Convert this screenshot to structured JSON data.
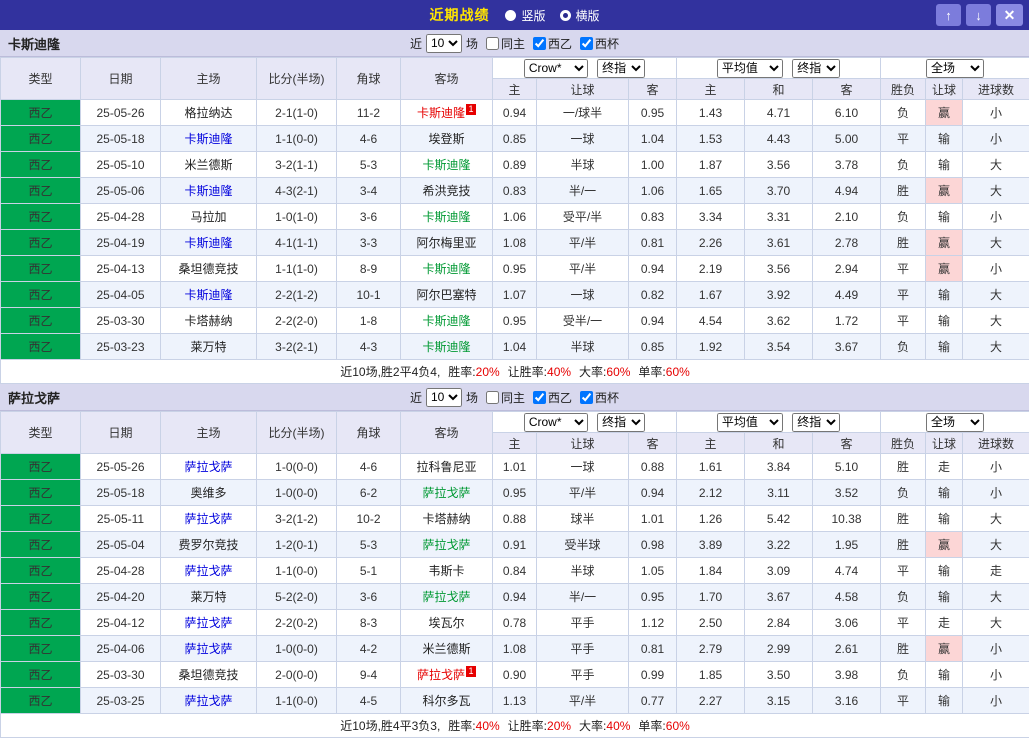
{
  "topbar": {
    "title": "近期战绩",
    "radios": [
      {
        "label": "竖版",
        "checked": false
      },
      {
        "label": "横版",
        "checked": true
      }
    ],
    "buttons": {
      "up": "↑",
      "down": "↓",
      "close": "✕"
    }
  },
  "colors": {
    "bar_purple": "#32329e",
    "title_yellow": "#ffe400",
    "league_green": "#00a651",
    "score_red": "#e60000",
    "home_team_blue": "#0000dd",
    "away_team_green": "#009933",
    "result_red": "#e60000",
    "result_blue": "#0000e6",
    "result_green": "#009933",
    "section_bar": "#d8d8ee",
    "header_lavender": "#e7e7f6",
    "row_alt": "#eef3fc"
  },
  "sections": [
    {
      "team": "卡斯迪隆",
      "filter": {
        "near": "近",
        "count": "10",
        "games": "场",
        "checkboxes": [
          {
            "label": "同主",
            "checked": false
          },
          {
            "label": "西乙",
            "checked": true
          },
          {
            "label": "西杯",
            "checked": true
          }
        ]
      },
      "columns": {
        "type": "类型",
        "date": "日期",
        "home": "主场",
        "score": "比分(半场)",
        "corner": "角球",
        "away": "客场"
      },
      "dropdowns": {
        "asia_company": "Crow*",
        "asia_final": "终指",
        "euro_company": "平均值",
        "euro_final": "终指",
        "scope": "全场"
      },
      "subcols": [
        "主",
        "让球",
        "客",
        "主",
        "和",
        "客",
        "胜负",
        "让球",
        "进球数"
      ],
      "rows": [
        {
          "league": "西乙",
          "date": "25-05-26",
          "home": "格拉纳达",
          "home_color": "black",
          "away": "卡斯迪隆",
          "away_color": "red",
          "away_badge": "1",
          "score": "2-1(1-0)",
          "corner": "11-2",
          "asia": [
            "0.94",
            "一/球半",
            "0.95"
          ],
          "euro": [
            "1.43",
            "4.71",
            "6.10"
          ],
          "result": [
            "负",
            "赢",
            "小"
          ]
        },
        {
          "league": "西乙",
          "date": "25-05-18",
          "home": "卡斯迪隆",
          "home_color": "blue",
          "away": "埃登斯",
          "away_color": "black",
          "score": "1-1(0-0)",
          "corner": "4-6",
          "asia": [
            "0.85",
            "一球",
            "1.04"
          ],
          "euro": [
            "1.53",
            "4.43",
            "5.00"
          ],
          "result": [
            "平",
            "输",
            "小"
          ]
        },
        {
          "league": "西乙",
          "date": "25-05-10",
          "home": "米兰德斯",
          "home_color": "black",
          "away": "卡斯迪隆",
          "away_color": "green",
          "score": "3-2(1-1)",
          "corner": "5-3",
          "asia": [
            "0.89",
            "半球",
            "1.00"
          ],
          "euro": [
            "1.87",
            "3.56",
            "3.78"
          ],
          "result": [
            "负",
            "输",
            "大"
          ]
        },
        {
          "league": "西乙",
          "date": "25-05-06",
          "home": "卡斯迪隆",
          "home_color": "blue",
          "away": "希洪竞技",
          "away_color": "black",
          "score": "4-3(2-1)",
          "corner": "3-4",
          "asia": [
            "0.83",
            "半/一",
            "1.06"
          ],
          "euro": [
            "1.65",
            "3.70",
            "4.94"
          ],
          "result": [
            "胜",
            "赢",
            "大"
          ]
        },
        {
          "league": "西乙",
          "date": "25-04-28",
          "home": "马拉加",
          "home_color": "black",
          "away": "卡斯迪隆",
          "away_color": "green",
          "score": "1-0(1-0)",
          "corner": "3-6",
          "asia": [
            "1.06",
            "受平/半",
            "0.83"
          ],
          "euro": [
            "3.34",
            "3.31",
            "2.10"
          ],
          "result": [
            "负",
            "输",
            "小"
          ]
        },
        {
          "league": "西乙",
          "date": "25-04-19",
          "home": "卡斯迪隆",
          "home_color": "blue",
          "away": "阿尔梅里亚",
          "away_color": "black",
          "score": "4-1(1-1)",
          "corner": "3-3",
          "asia": [
            "1.08",
            "平/半",
            "0.81"
          ],
          "euro": [
            "2.26",
            "3.61",
            "2.78"
          ],
          "result": [
            "胜",
            "赢",
            "大"
          ]
        },
        {
          "league": "西乙",
          "date": "25-04-13",
          "home": "桑坦德竞技",
          "home_color": "black",
          "away": "卡斯迪隆",
          "away_color": "green",
          "score": "1-1(1-0)",
          "corner": "8-9",
          "asia": [
            "0.95",
            "平/半",
            "0.94"
          ],
          "euro": [
            "2.19",
            "3.56",
            "2.94"
          ],
          "result": [
            "平",
            "赢",
            "小"
          ]
        },
        {
          "league": "西乙",
          "date": "25-04-05",
          "home": "卡斯迪隆",
          "home_color": "blue",
          "away": "阿尔巴塞特",
          "away_color": "black",
          "score": "2-2(1-2)",
          "corner": "10-1",
          "asia": [
            "1.07",
            "一球",
            "0.82"
          ],
          "euro": [
            "1.67",
            "3.92",
            "4.49"
          ],
          "result": [
            "平",
            "输",
            "大"
          ]
        },
        {
          "league": "西乙",
          "date": "25-03-30",
          "home": "卡塔赫纳",
          "home_color": "black",
          "away": "卡斯迪隆",
          "away_color": "green",
          "score": "2-2(2-0)",
          "corner": "1-8",
          "asia": [
            "0.95",
            "受半/一",
            "0.94"
          ],
          "euro": [
            "4.54",
            "3.62",
            "1.72"
          ],
          "result": [
            "平",
            "输",
            "大"
          ]
        },
        {
          "league": "西乙",
          "date": "25-03-23",
          "home": "莱万特",
          "home_color": "black",
          "away": "卡斯迪隆",
          "away_color": "green",
          "score": "3-2(2-1)",
          "corner": "4-3",
          "asia": [
            "1.04",
            "半球",
            "0.85"
          ],
          "euro": [
            "1.92",
            "3.54",
            "3.67"
          ],
          "result": [
            "负",
            "输",
            "大"
          ]
        }
      ],
      "summary": {
        "prefix": "近10场,胜2平4负4,",
        "stats": [
          {
            "label": "胜率:",
            "value": "20%"
          },
          {
            "label": "让胜率:",
            "value": "40%"
          },
          {
            "label": "大率:",
            "value": "60%"
          },
          {
            "label": "单率:",
            "value": "60%"
          }
        ]
      }
    },
    {
      "team": "萨拉戈萨",
      "filter": {
        "near": "近",
        "count": "10",
        "games": "场",
        "checkboxes": [
          {
            "label": "同主",
            "checked": false
          },
          {
            "label": "西乙",
            "checked": true
          },
          {
            "label": "西杯",
            "checked": true
          }
        ]
      },
      "columns": {
        "type": "类型",
        "date": "日期",
        "home": "主场",
        "score": "比分(半场)",
        "corner": "角球",
        "away": "客场"
      },
      "dropdowns": {
        "asia_company": "Crow*",
        "asia_final": "终指",
        "euro_company": "平均值",
        "euro_final": "终指",
        "scope": "全场"
      },
      "subcols": [
        "主",
        "让球",
        "客",
        "主",
        "和",
        "客",
        "胜负",
        "让球",
        "进球数"
      ],
      "rows": [
        {
          "league": "西乙",
          "date": "25-05-26",
          "home": "萨拉戈萨",
          "home_color": "blue",
          "away": "拉科鲁尼亚",
          "away_color": "black",
          "score": "1-0(0-0)",
          "corner": "4-6",
          "asia": [
            "1.01",
            "一球",
            "0.88"
          ],
          "euro": [
            "1.61",
            "3.84",
            "5.10"
          ],
          "result": [
            "胜",
            "走",
            "小"
          ]
        },
        {
          "league": "西乙",
          "date": "25-05-18",
          "home": "奥维多",
          "home_color": "black",
          "away": "萨拉戈萨",
          "away_color": "green",
          "score": "1-0(0-0)",
          "corner": "6-2",
          "asia": [
            "0.95",
            "平/半",
            "0.94"
          ],
          "euro": [
            "2.12",
            "3.11",
            "3.52"
          ],
          "result": [
            "负",
            "输",
            "小"
          ]
        },
        {
          "league": "西乙",
          "date": "25-05-11",
          "home": "萨拉戈萨",
          "home_color": "blue",
          "away": "卡塔赫纳",
          "away_color": "black",
          "score": "3-2(1-2)",
          "corner": "10-2",
          "asia": [
            "0.88",
            "球半",
            "1.01"
          ],
          "euro": [
            "1.26",
            "5.42",
            "10.38"
          ],
          "result": [
            "胜",
            "输",
            "大"
          ]
        },
        {
          "league": "西乙",
          "date": "25-05-04",
          "home": "费罗尔竞技",
          "home_color": "black",
          "away": "萨拉戈萨",
          "away_color": "green",
          "score": "1-2(0-1)",
          "corner": "5-3",
          "asia": [
            "0.91",
            "受半球",
            "0.98"
          ],
          "euro": [
            "3.89",
            "3.22",
            "1.95"
          ],
          "result": [
            "胜",
            "赢",
            "大"
          ]
        },
        {
          "league": "西乙",
          "date": "25-04-28",
          "home": "萨拉戈萨",
          "home_color": "blue",
          "away": "韦斯卡",
          "away_color": "black",
          "score": "1-1(0-0)",
          "corner": "5-1",
          "asia": [
            "0.84",
            "半球",
            "1.05"
          ],
          "euro": [
            "1.84",
            "3.09",
            "4.74"
          ],
          "result": [
            "平",
            "输",
            "走"
          ]
        },
        {
          "league": "西乙",
          "date": "25-04-20",
          "home": "莱万特",
          "home_color": "black",
          "away": "萨拉戈萨",
          "away_color": "green",
          "score": "5-2(2-0)",
          "corner": "3-6",
          "asia": [
            "0.94",
            "半/一",
            "0.95"
          ],
          "euro": [
            "1.70",
            "3.67",
            "4.58"
          ],
          "result": [
            "负",
            "输",
            "大"
          ]
        },
        {
          "league": "西乙",
          "date": "25-04-12",
          "home": "萨拉戈萨",
          "home_color": "blue",
          "away": "埃瓦尔",
          "away_color": "black",
          "score": "2-2(0-2)",
          "corner": "8-3",
          "asia": [
            "0.78",
            "平手",
            "1.12"
          ],
          "euro": [
            "2.50",
            "2.84",
            "3.06"
          ],
          "result": [
            "平",
            "走",
            "大"
          ]
        },
        {
          "league": "西乙",
          "date": "25-04-06",
          "home": "萨拉戈萨",
          "home_color": "blue",
          "away": "米兰德斯",
          "away_color": "black",
          "score": "1-0(0-0)",
          "corner": "4-2",
          "asia": [
            "1.08",
            "平手",
            "0.81"
          ],
          "euro": [
            "2.79",
            "2.99",
            "2.61"
          ],
          "result": [
            "胜",
            "赢",
            "小"
          ]
        },
        {
          "league": "西乙",
          "date": "25-03-30",
          "home": "桑坦德竞技",
          "home_color": "black",
          "away": "萨拉戈萨",
          "away_color": "red",
          "away_badge": "1",
          "score": "2-0(0-0)",
          "corner": "9-4",
          "asia": [
            "0.90",
            "平手",
            "0.99"
          ],
          "euro": [
            "1.85",
            "3.50",
            "3.98"
          ],
          "result": [
            "负",
            "输",
            "小"
          ]
        },
        {
          "league": "西乙",
          "date": "25-03-25",
          "home": "萨拉戈萨",
          "home_color": "blue",
          "away": "科尔多瓦",
          "away_color": "black",
          "score": "1-1(0-0)",
          "corner": "4-5",
          "asia": [
            "1.13",
            "平/半",
            "0.77"
          ],
          "euro": [
            "2.27",
            "3.15",
            "3.16"
          ],
          "result": [
            "平",
            "输",
            "小"
          ]
        }
      ],
      "summary": {
        "prefix": "近10场,胜4平3负3,",
        "stats": [
          {
            "label": "胜率:",
            "value": "40%"
          },
          {
            "label": "让胜率:",
            "value": "20%"
          },
          {
            "label": "大率:",
            "value": "40%"
          },
          {
            "label": "单率:",
            "value": "60%"
          }
        ]
      }
    }
  ]
}
